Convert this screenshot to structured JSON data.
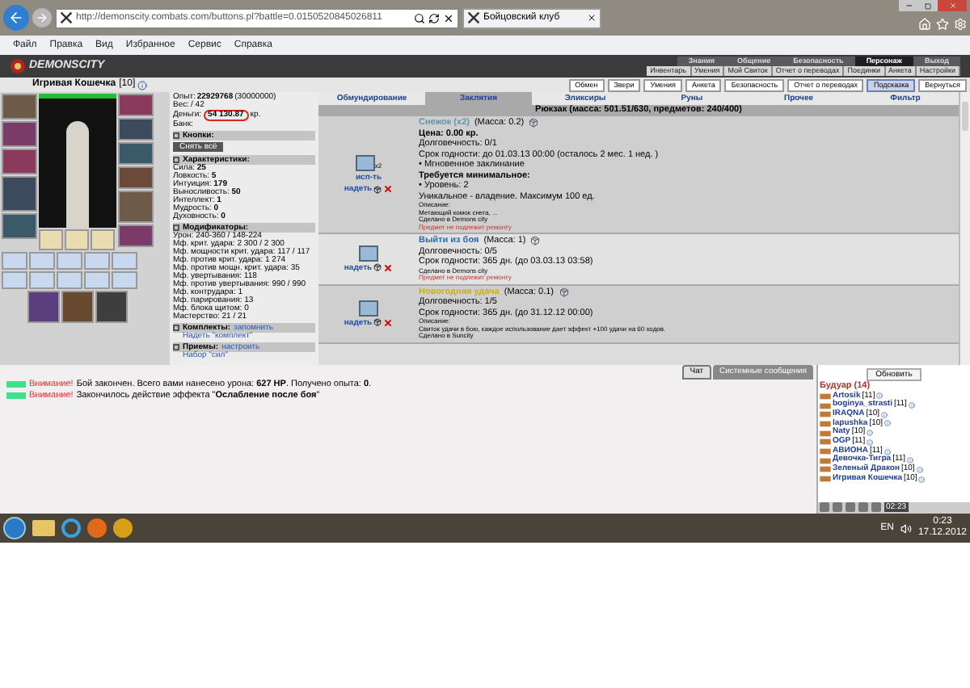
{
  "browser": {
    "address": "http://demonscity.combats.com/buttons.pl?battle=0.0150520845026811",
    "tab_title": "Бойцовский клуб",
    "menu": [
      "Файл",
      "Правка",
      "Вид",
      "Избранное",
      "Сервис",
      "Справка"
    ]
  },
  "game_header": {
    "logo": "DEMONSCITY",
    "top_nav": [
      {
        "label": "Знания",
        "selected": false
      },
      {
        "label": "Общение",
        "selected": false
      },
      {
        "label": "Безопасность",
        "selected": false
      },
      {
        "label": "Персонаж",
        "selected": true
      },
      {
        "label": "Выход",
        "selected": false
      }
    ],
    "sub_nav": [
      "Инвентарь",
      "Умения",
      "Мой Свиток",
      "Отчет о переводах",
      "Поединки",
      "Анкета",
      "Настройки"
    ]
  },
  "character": {
    "name": "Игривая Кошечка",
    "level": "[10]",
    "health": {
      "level": 1
    },
    "buttons": [
      {
        "label": "Обмен",
        "selected": false
      },
      {
        "label": "Звери",
        "selected": false
      },
      {
        "label": "Умения",
        "selected": false
      },
      {
        "label": "Анкета",
        "selected": false
      },
      {
        "label": "Безопасность",
        "selected": false
      },
      {
        "label": "Отчет о переводах",
        "selected": false
      },
      {
        "label": "Подсказка",
        "selected": true
      },
      {
        "label": "Вернуться",
        "selected": false
      }
    ]
  },
  "stats": {
    "top": [
      {
        "label": "Опыт:",
        "value": "22929768",
        "extra": "(30000000)"
      },
      {
        "label": "Вес:",
        "extra": "/ 42"
      },
      {
        "label": "Деньги:",
        "value": "54 130.87",
        "extra": "кр."
      },
      {
        "label": "Банк:"
      }
    ],
    "buttons_title": "Кнопки:",
    "remove_all": "Снять всё",
    "characteristics_title": "Характеристики:",
    "characteristics": [
      {
        "label": "Сила:",
        "value": "25"
      },
      {
        "label": "Ловкость:",
        "value": "5"
      },
      {
        "label": "Интуиция:",
        "value": "179"
      },
      {
        "label": "Выносливость:",
        "value": "50"
      },
      {
        "label": "Интеллект:",
        "value": "1"
      },
      {
        "label": "Мудрость:",
        "value": "0"
      },
      {
        "label": "Духовность:",
        "value": "0"
      }
    ],
    "modifiers_title": "Модификаторы:",
    "modifiers": [
      {
        "label": "Урон:",
        "value": "240-360 / 148-224"
      },
      {
        "label": "Мф. крит. удара:",
        "value": "2 300 / 2 300"
      },
      {
        "label": "Мф. мощности крит. удара:",
        "value": "117 / 117"
      },
      {
        "label": "Мф. против крит. удара:",
        "value": "1 274"
      },
      {
        "label": "Мф. против мощн. крит. удара:",
        "value": "35"
      },
      {
        "label": "Мф. увертывания:",
        "value": "118"
      },
      {
        "label": "Мф. против увертывания:",
        "value": "990 / 990"
      },
      {
        "label": "Мф. контрудара:",
        "value": "1"
      },
      {
        "label": "Мф. парирования:",
        "value": "13"
      },
      {
        "label": "Мф. блока щитом:",
        "value": "0"
      },
      {
        "label": "Мастерство:",
        "value": "21 / 21"
      }
    ],
    "sets_title": "Комплекты:",
    "sets_link": "запомнить",
    "set_item": "Надеть \"комплект\"",
    "tricks_title": "Приемы:",
    "tricks_link": "настроить",
    "trick_item": "Набор \"сил\""
  },
  "inventory": {
    "tabs": [
      {
        "label": "Обмундирование",
        "selected": false
      },
      {
        "label": "Заклятия",
        "selected": true
      },
      {
        "label": "Эликсиры",
        "selected": false
      },
      {
        "label": "Руны",
        "selected": false
      },
      {
        "label": "Прочее",
        "selected": false
      },
      {
        "label": "Фильтр",
        "selected": false
      }
    ],
    "backpack": "Рюкзак (масса: 501.51/630, предметов: 240/400)",
    "items": [
      {
        "name": "Снежок (x2)",
        "color": "#5f97a8",
        "mass": "(Масса: 0.2)",
        "count": "x2",
        "actions": [
          "исп-ть",
          "надеть"
        ],
        "lines": [
          {
            "kind": "bold",
            "text": "Цена: 0.00 кр."
          },
          {
            "kind": "normal",
            "text": "Долговечность: 0/1"
          },
          {
            "kind": "normal",
            "text": "Срок годности: до 01.03.13 00:00 (осталось 2 мес. 1 нед. )"
          },
          {
            "kind": "normal",
            "text": "• Мгновенное заклинание"
          },
          {
            "kind": "bold",
            "text": "Требуется минимальное:"
          },
          {
            "kind": "normal",
            "text": "• Уровень: 2"
          },
          {
            "kind": "normal",
            "text": "Уникальное - владение. Максимум 100 ед."
          },
          {
            "kind": "tiny",
            "text": "Описание:"
          },
          {
            "kind": "tiny",
            "text": "Метающий комок снега, ..."
          },
          {
            "kind": "tiny",
            "text": "Сделано в Demons city"
          },
          {
            "kind": "red",
            "text": "Предмет не подлежит ремонту"
          }
        ]
      },
      {
        "name": "Выйти из боя",
        "color": "#2f6aa6",
        "mass": "(Масса: 1)",
        "actions": [
          "надеть"
        ],
        "lines": [
          {
            "kind": "normal",
            "text": "Долговечность: 0/5"
          },
          {
            "kind": "normal",
            "text": "Срок годности: 365 дн. (до 03.03.13 03:58)"
          },
          {
            "kind": "tiny",
            "text": "Сделано в Demons city"
          },
          {
            "kind": "red",
            "text": "Предмет не подлежит ремонту"
          }
        ]
      },
      {
        "name": "Новогодняя удача",
        "color": "#c9b300",
        "mass": "(Масса: 0.1)",
        "actions": [
          "надеть"
        ],
        "lines": [
          {
            "kind": "normal",
            "text": "Долговечность: 1/5"
          },
          {
            "kind": "normal",
            "text": "Срок годности: 365 дн. (до 31.12.12 00:00)"
          },
          {
            "kind": "tiny",
            "text": "Описание:"
          },
          {
            "kind": "tiny",
            "text": "Свиток удачи в бою, каждое использование дает эффект +100 удачи на 60 ходов."
          },
          {
            "kind": "tiny",
            "text": "Сделано в Suncity"
          }
        ]
      }
    ]
  },
  "chat": {
    "tabs": [
      {
        "label": "Чат",
        "selected": true
      },
      {
        "label": "Системные сообщения",
        "selected": false
      }
    ],
    "messages": [
      {
        "warning": "Внимание!",
        "text": "Бой закончен. Всего вами нанесено урона: **627 HP**. Получено опыта: **0**."
      },
      {
        "warning": "Внимание!",
        "text": "Закончилось действие эффекта \"**Ослабление после боя**\""
      }
    ]
  },
  "users": {
    "refresh": "Обновить",
    "room": "Будуар (14)",
    "list": [
      {
        "name": "Artosik",
        "level": "[11]"
      },
      {
        "name": "boginya_strasti",
        "level": "[11]"
      },
      {
        "name": "IRAQNA",
        "level": "[10]"
      },
      {
        "name": "lapushka",
        "level": "[10]"
      },
      {
        "name": "Naty",
        "level": "[10]"
      },
      {
        "name": "OGP",
        "level": "[11]"
      },
      {
        "name": "АВИОНА",
        "level": "[11]"
      },
      {
        "name": "Девочка-Тигра",
        "level": "[11]"
      },
      {
        "name": "Зеленый Дракон",
        "level": "[10]"
      },
      {
        "name": "Игривая Кошечка",
        "level": "[10]"
      }
    ],
    "clock": "02:23"
  },
  "taskbar": {
    "language": "EN",
    "time": "0:23",
    "date": "17.12.2012"
  }
}
